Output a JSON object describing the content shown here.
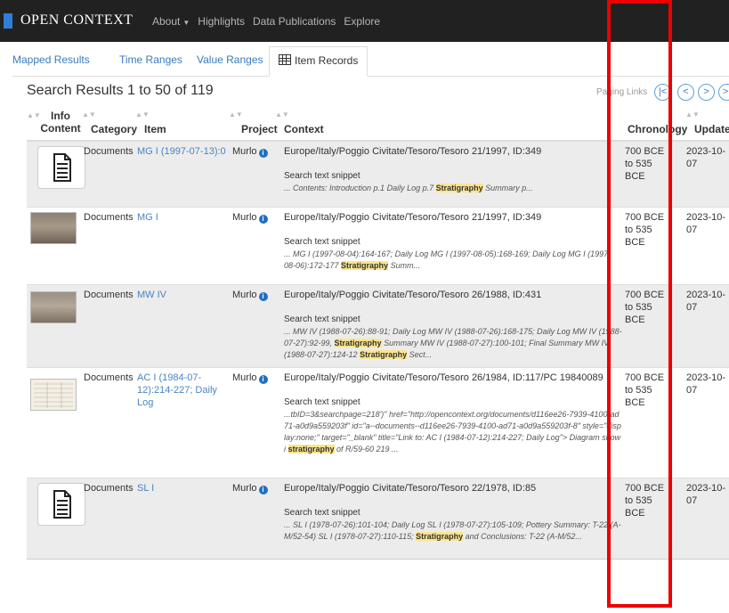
{
  "navbar": {
    "brand": "OPEN CONTEXT",
    "links": [
      "About",
      "Highlights",
      "Data Publications",
      "Explore"
    ]
  },
  "tabs": [
    "Mapped Results",
    "Time Ranges",
    "Value Ranges",
    "Item Records"
  ],
  "results_title": "Search Results 1 to 50 of 119",
  "paging": {
    "label": "Paging Links",
    "first": "|<",
    "prev": "<",
    "next": ">",
    "last": ">|"
  },
  "columns": [
    "Info Content",
    "Category",
    "Item",
    "Project",
    "Context",
    "Chronology",
    "Updated"
  ],
  "snippet_label": "Search text snippet",
  "rows": [
    {
      "thumb": "document-icon",
      "category": "Documents",
      "item": "MG I (1997-07-13):0",
      "project": "Murlo",
      "context": "Europe/Italy/Poggio Civitate/Tesoro/Tesoro 21/1997, ID:349",
      "snippet": [
        {
          "t": "...  Contents:  Introduction p.1   Daily Log p.7  "
        },
        {
          "t": "Stratigraphy",
          "hl": true
        },
        {
          "t": " Summary p..."
        }
      ],
      "chronology": "700 BCE to 535 BCE",
      "updated": "2023-10-07"
    },
    {
      "thumb": "photo",
      "category": "Documents",
      "item": "MG I",
      "project": "Murlo",
      "context": "Europe/Italy/Poggio Civitate/Tesoro/Tesoro 21/1997, ID:349",
      "snippet": [
        {
          "t": "... MG I (1997-08-04):164-167; Daily Log  MG I (1997-08-05):168-169; Daily Log MG I (1997-08-06):172-177 "
        },
        {
          "t": "Stratigraphy",
          "hl": true
        },
        {
          "t": " Summ..."
        }
      ],
      "chronology": "700 BCE to 535 BCE",
      "updated": "2023-10-07"
    },
    {
      "thumb": "photo",
      "category": "Documents",
      "item": "MW IV",
      "project": "Murlo",
      "context": "Europe/Italy/Poggio Civitate/Tesoro/Tesoro 26/1988, ID:431",
      "snippet": [
        {
          "t": "... MW IV (1988-07-26):88-91; Daily Log MW IV (1988-07-26):168-175; Daily Log MW IV (1988-07-27):92-99, "
        },
        {
          "t": "Stratigraphy",
          "hl": true
        },
        {
          "t": " Summary  MW IV (1988-07-27):100-101; Final Summary MW IV (1988-07-27):124-12 "
        },
        {
          "t": "Stratigraphy",
          "hl": true
        },
        {
          "t": "  Sect..."
        }
      ],
      "chronology": "700 BCE to 535 BCE",
      "updated": "2023-10-07"
    },
    {
      "thumb": "page-scan",
      "category": "Documents",
      "item": "AC I (1984-07-12):214-227; Daily Log",
      "project": "Murlo",
      "context": "Europe/Italy/Poggio Civitate/Tesoro/Tesoro 26/1984, ID:117/PC 19840089",
      "snippet": [
        {
          "t": "...tbID=3&searchpage=218')\" href=\"http://opencontext.org/documents/d116ee26-7939-4100-ad71-a0d9a559203f\" id=\"a--documents--d116ee26-7939-4100-ad71-a0d9a559203f-8\" style=\"display:none;\" target=\"_blank\" title=\"Link to: AC I (1984-07-12):214-227; Daily Log\">  Diagram showi "
        },
        {
          "t": "stratigraphy",
          "hl": true
        },
        {
          "t": "  of R/59-60  219 ..."
        }
      ],
      "chronology": "700 BCE to 535 BCE",
      "updated": "2023-10-07"
    },
    {
      "thumb": "document-icon",
      "category": "Documents",
      "item": "SL I",
      "project": "Murlo",
      "context": "Europe/Italy/Poggio Civitate/Tesoro/Tesoro 22/1978, ID:85",
      "snippet": [
        {
          "t": "... SL I (1978-07-26):101-104; Daily Log  SL I (1978-07-27):105-109; Pottery Summary: T-22 (A-M/52-54) SL I (1978-07-27):110-115; "
        },
        {
          "t": "Stratigraphy",
          "hl": true
        },
        {
          "t": "  and Conclusions: T-22 (A-M/52..."
        }
      ],
      "chronology": "700 BCE to 535 BCE",
      "updated": "2023-10-07"
    }
  ],
  "colors": {
    "navbar": "#212121",
    "link": "#4a84c1",
    "highlight": "#fbe58d",
    "annotation": "#ee0000",
    "row_shade": "#ececec"
  }
}
